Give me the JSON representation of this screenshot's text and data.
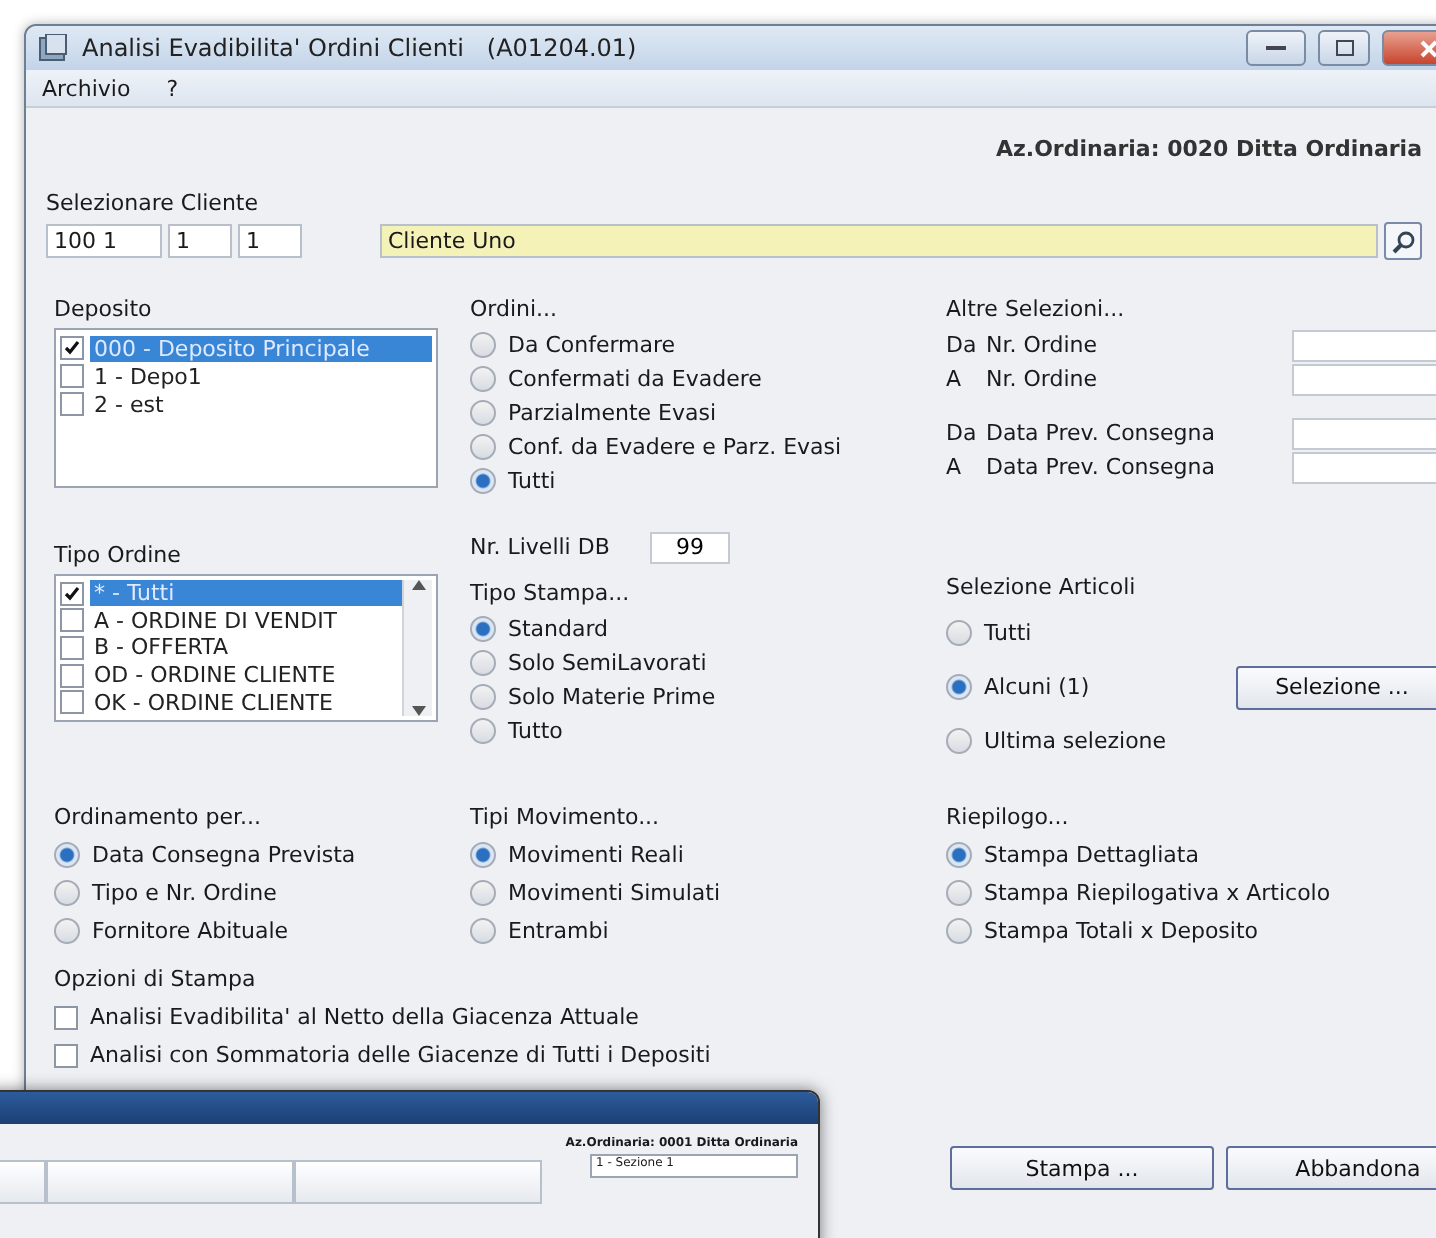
{
  "window": {
    "title": "Analisi Evadibilita' Ordini Clienti   (A01204.01)"
  },
  "menu": [
    "Archivio",
    "?"
  ],
  "company": "Az.Ordinaria: 0020 Ditta Ordinaria",
  "customer": {
    "label": "Selezionare Cliente",
    "codes": [
      "100 1",
      "1",
      "1"
    ],
    "name": "Cliente Uno"
  },
  "deposito": {
    "label": "Deposito",
    "items": [
      {
        "text": "000 - Deposito Principale",
        "checked": true,
        "selected": true
      },
      {
        "text": "1 - Depo1",
        "checked": false,
        "selected": false
      },
      {
        "text": "2 - est",
        "checked": false,
        "selected": false
      }
    ]
  },
  "ordini": {
    "label": "Ordini...",
    "options": [
      {
        "text": "Da Confermare",
        "selected": false
      },
      {
        "text": "Confermati da Evadere",
        "selected": false
      },
      {
        "text": "Parzialmente Evasi",
        "selected": false
      },
      {
        "text": "Conf. da Evadere e Parz. Evasi",
        "selected": false
      },
      {
        "text": "Tutti",
        "selected": true
      }
    ]
  },
  "altre_selezioni": {
    "label": "Altre Selezioni...",
    "fields": [
      {
        "prefix": "Da",
        "label": "Nr. Ordine"
      },
      {
        "prefix": "A",
        "label": "Nr. Ordine"
      },
      {
        "prefix": "Da",
        "label": "Data Prev. Consegna"
      },
      {
        "prefix": "A",
        "label": "Data Prev. Consegna"
      }
    ]
  },
  "tipo_ordine": {
    "label": "Tipo Ordine",
    "items": [
      {
        "text": "* - Tutti",
        "checked": true,
        "selected": true
      },
      {
        "text": "A - ORDINE DI VENDIT",
        "checked": false,
        "selected": false
      },
      {
        "text": "B - OFFERTA",
        "checked": false,
        "selected": false
      },
      {
        "text": "OD - ORDINE CLIENTE",
        "checked": false,
        "selected": false
      },
      {
        "text": "OK - ORDINE CLIENTE",
        "checked": false,
        "selected": false
      }
    ]
  },
  "livelli": {
    "label": "Nr. Livelli DB",
    "value": "99"
  },
  "tipo_stampa": {
    "label": "Tipo Stampa...",
    "options": [
      {
        "text": "Standard",
        "selected": true
      },
      {
        "text": "Solo SemiLavorati",
        "selected": false
      },
      {
        "text": "Solo Materie Prime",
        "selected": false
      },
      {
        "text": "Tutto",
        "selected": false
      }
    ]
  },
  "selezione_articoli": {
    "label": "Selezione Articoli",
    "options": [
      {
        "text": "Tutti",
        "selected": false
      },
      {
        "text": "Alcuni (1)",
        "selected": true
      },
      {
        "text": "Ultima selezione",
        "selected": false
      }
    ],
    "button": "Selezione ..."
  },
  "ordinamento": {
    "label": "Ordinamento per...",
    "options": [
      {
        "text": "Data Consegna Prevista",
        "selected": true
      },
      {
        "text": "Tipo e Nr. Ordine",
        "selected": false
      },
      {
        "text": "Fornitore Abituale",
        "selected": false
      }
    ]
  },
  "tipi_movimento": {
    "label": "Tipi Movimento...",
    "options": [
      {
        "text": "Movimenti Reali",
        "selected": true
      },
      {
        "text": "Movimenti Simulati",
        "selected": false
      },
      {
        "text": "Entrambi",
        "selected": false
      }
    ]
  },
  "riepilogo": {
    "label": "Riepilogo...",
    "options": [
      {
        "text": "Stampa Dettagliata",
        "selected": true
      },
      {
        "text": "Stampa Riepilogativa x Articolo",
        "selected": false
      },
      {
        "text": "Stampa Totali x Deposito",
        "selected": false
      }
    ]
  },
  "opzioni_stampa": {
    "label": "Opzioni di Stampa",
    "items": [
      {
        "text": "Analisi Evadibilita' al Netto della Giacenza Attuale",
        "checked": false
      },
      {
        "text": "Analisi con Sommatoria delle Giacenze di Tutti i Depositi",
        "checked": false
      }
    ]
  },
  "buttons": [
    "Stampa ...",
    "Abbandona"
  ],
  "back_window": {
    "company": "Az.Ordinaria: 0001 Ditta Ordinaria",
    "section": "1 - Sezione 1"
  }
}
